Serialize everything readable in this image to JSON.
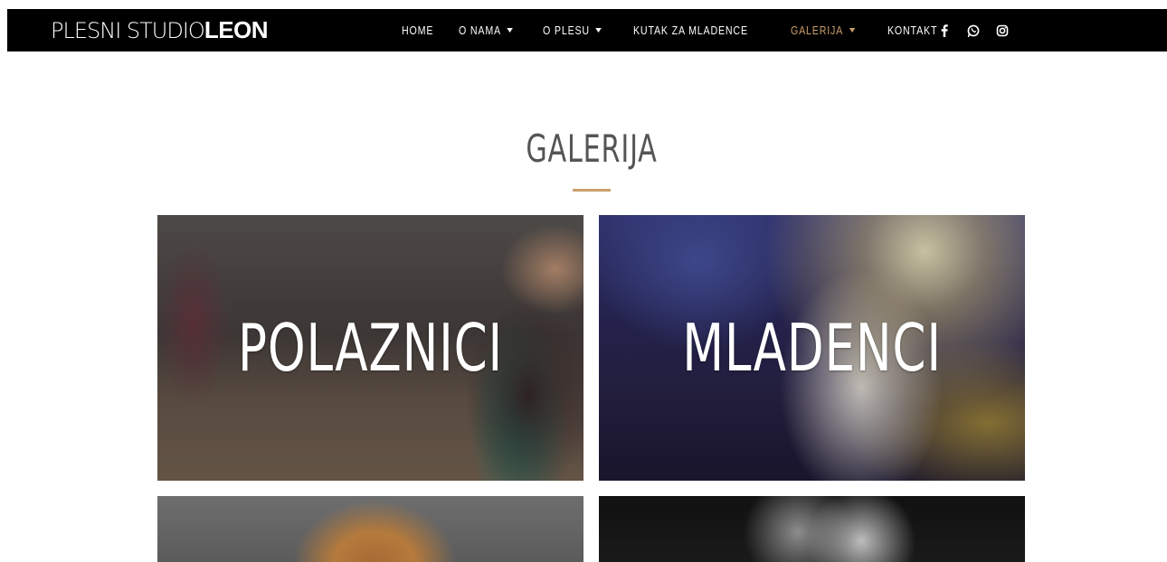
{
  "nav": {
    "logo_light": "PLESNI STUDIO",
    "logo_bold": "LEON",
    "items": [
      {
        "label": "HOME",
        "has_caret": false,
        "active": false
      },
      {
        "label": "O NAMA",
        "has_caret": true,
        "active": false
      },
      {
        "label": "O PLESU",
        "has_caret": true,
        "active": false
      },
      {
        "label": "KUTAK ZA MLADENCE",
        "has_caret": false,
        "active": false
      },
      {
        "label": "GALERIJA",
        "has_caret": true,
        "active": true
      },
      {
        "label": "KONTAKT",
        "has_caret": false,
        "active": false
      }
    ],
    "social_icons": [
      "facebook-icon",
      "whatsapp-icon",
      "instagram-icon"
    ]
  },
  "page": {
    "title": "GALERIJA"
  },
  "gallery": {
    "tiles": [
      {
        "label": "POLAZNICI"
      },
      {
        "label": "MLADENCI"
      },
      {
        "label": ""
      },
      {
        "label": ""
      }
    ]
  },
  "colors": {
    "accent": "#c9a06b",
    "navbar_bg": "#000000",
    "title": "#555555"
  }
}
